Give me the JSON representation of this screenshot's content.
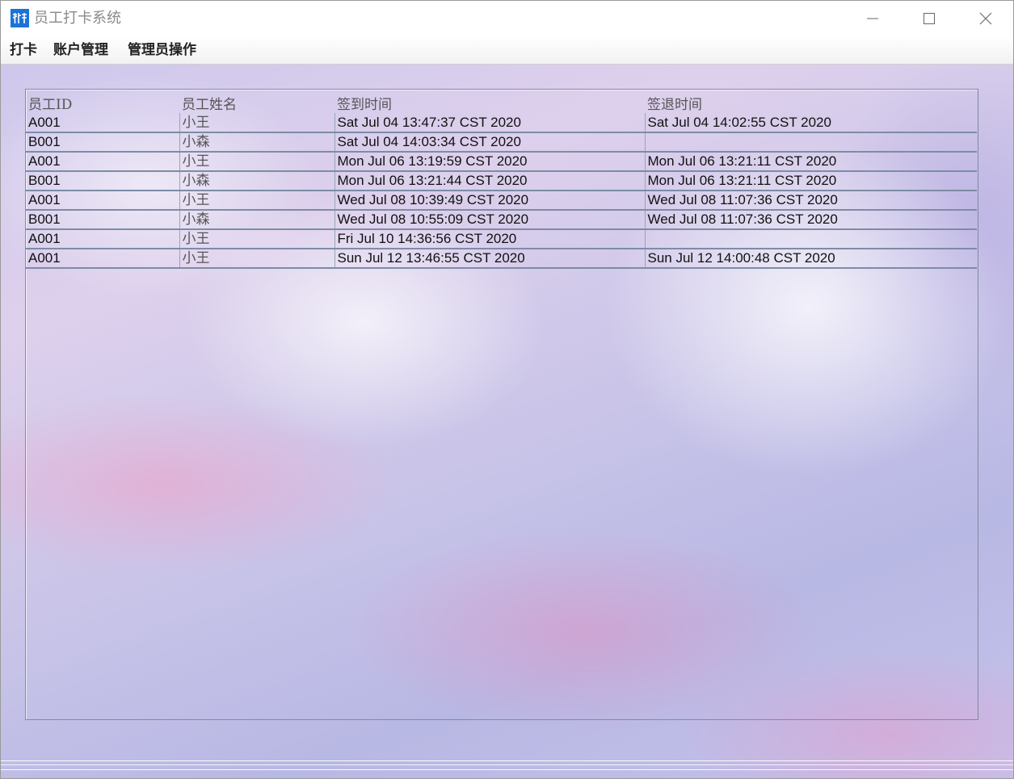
{
  "window": {
    "title": "员工打卡系统",
    "app_icon": "clock-in-app-icon",
    "controls": [
      "minimize-icon",
      "maximize-icon",
      "close-icon"
    ]
  },
  "menu": {
    "items": [
      {
        "label": "打卡"
      },
      {
        "label": "账户管理"
      },
      {
        "label": "管理员操作"
      }
    ]
  },
  "table": {
    "columns": [
      "员工ID",
      "员工姓名",
      "签到时间",
      "签退时间"
    ],
    "rows": [
      {
        "id": "A001",
        "name": "小王",
        "sign_in": "Sat Jul 04 13:47:37 CST 2020",
        "sign_out": "Sat Jul 04 14:02:55 CST 2020"
      },
      {
        "id": "B001",
        "name": "小森",
        "sign_in": "Sat Jul 04 14:03:34 CST 2020",
        "sign_out": ""
      },
      {
        "id": "A001",
        "name": "小王",
        "sign_in": "Mon Jul 06 13:19:59 CST 2020",
        "sign_out": "Mon Jul 06 13:21:11 CST 2020"
      },
      {
        "id": "B001",
        "name": "小森",
        "sign_in": "Mon Jul 06 13:21:44 CST 2020",
        "sign_out": "Mon Jul 06 13:21:11 CST 2020"
      },
      {
        "id": "A001",
        "name": "小王",
        "sign_in": "Wed Jul 08 10:39:49 CST 2020",
        "sign_out": "Wed Jul 08 11:07:36 CST 2020"
      },
      {
        "id": "B001",
        "name": "小森",
        "sign_in": "Wed Jul 08 10:55:09 CST 2020",
        "sign_out": "Wed Jul 08 11:07:36 CST 2020"
      },
      {
        "id": "A001",
        "name": "小王",
        "sign_in": "Fri Jul 10 14:36:56 CST 2020",
        "sign_out": ""
      },
      {
        "id": "A001",
        "name": "小王",
        "sign_in": "Sun Jul 12 13:46:55 CST 2020",
        "sign_out": "Sun Jul 12 14:00:48 CST 2020"
      }
    ]
  }
}
